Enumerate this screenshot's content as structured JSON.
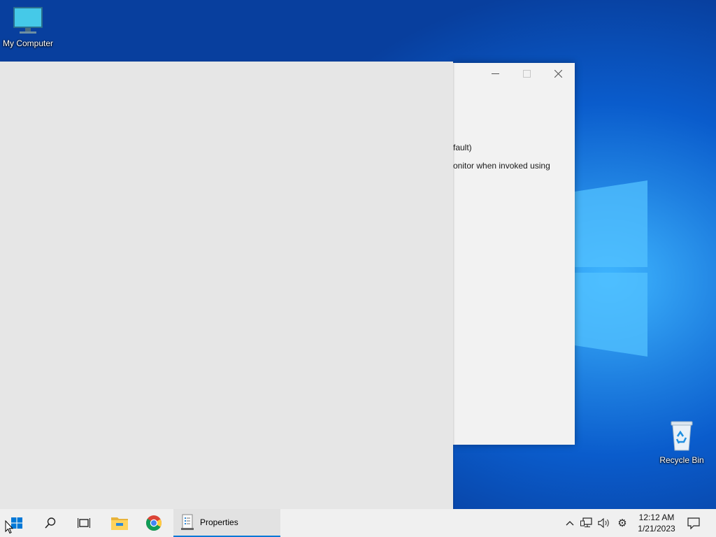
{
  "desktop": {
    "icons": [
      {
        "label": "My Computer",
        "icon": "monitor-icon"
      },
      {
        "label": "Recycle Bin",
        "icon": "recycle-bin-icon"
      }
    ]
  },
  "properties_window": {
    "controls": {
      "minimize": "minimize-icon",
      "maximize": "maximize-icon",
      "close": "close-icon"
    },
    "text_fragments": [
      "fault)",
      "onitor when invoked using"
    ]
  },
  "taskbar": {
    "start": "windows-start-icon",
    "search": "search-icon",
    "task_view": "task-view-icon",
    "pinned": [
      "file-explorer-icon",
      "chrome-icon"
    ],
    "open_window": {
      "title": "Properties",
      "icon": "properties-app-icon"
    },
    "tray": {
      "icons": [
        "chevron-up-icon",
        "network-icon",
        "volume-icon",
        "settings-icon"
      ],
      "time": "12:12 AM",
      "date": "1/21/2023",
      "notification_icon": "notification-icon"
    }
  },
  "colors": {
    "desktop_blue": "#0a5ccc",
    "accent": "#0078d7",
    "taskbar_bg": "#f0f0f0",
    "window_bg": "#f2f2f2",
    "panel_bg": "#e6e6e6"
  }
}
